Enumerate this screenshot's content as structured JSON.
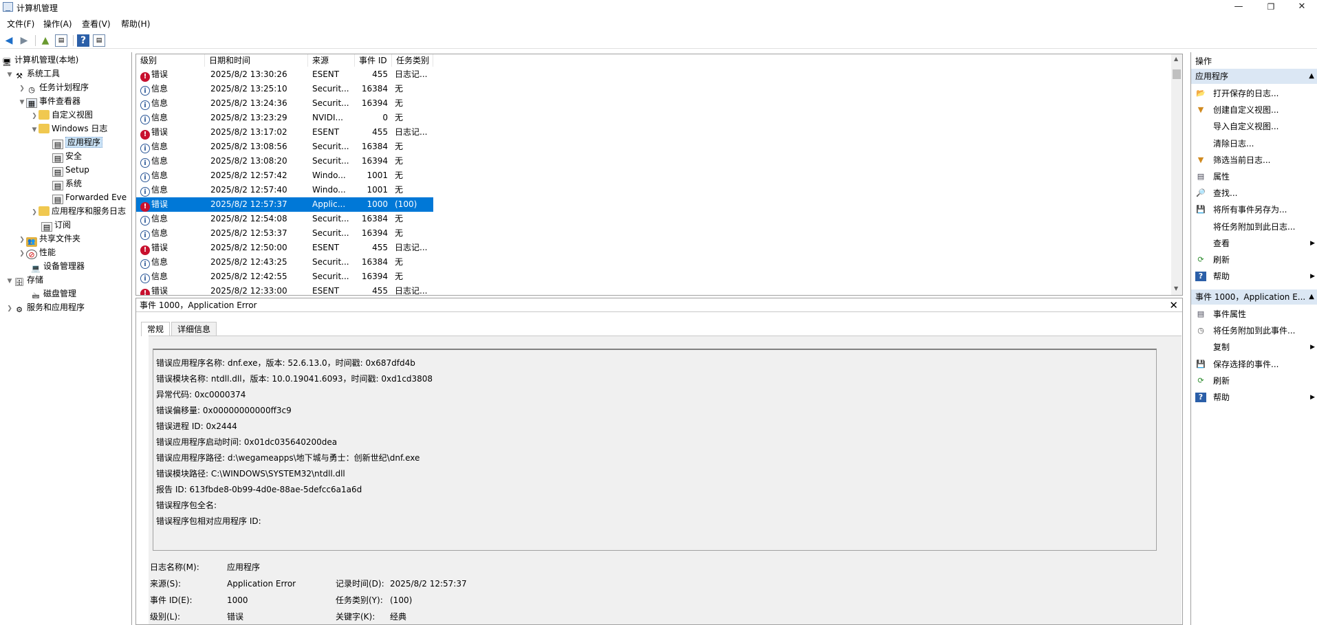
{
  "window": {
    "title": "计算机管理",
    "minimize": "—",
    "restore": "❐",
    "close": "✕"
  },
  "menu": [
    "文件(F)",
    "操作(A)",
    "查看(V)",
    "帮助(H)"
  ],
  "tree": [
    {
      "label": "计算机管理(本地)",
      "icon": "computer-icon"
    },
    {
      "label": "系统工具",
      "icon": "tools-icon"
    },
    {
      "label": "任务计划程序",
      "icon": "clock-icon"
    },
    {
      "label": "事件查看器",
      "icon": "event-viewer-icon"
    },
    {
      "label": "自定义视图",
      "icon": "folder-icon"
    },
    {
      "label": "Windows 日志",
      "icon": "folder-icon"
    },
    {
      "label": "应用程序",
      "icon": "log-icon"
    },
    {
      "label": "安全",
      "icon": "log-icon"
    },
    {
      "label": "Setup",
      "icon": "log-icon"
    },
    {
      "label": "系统",
      "icon": "log-icon"
    },
    {
      "label": "Forwarded Eve",
      "icon": "log-icon"
    },
    {
      "label": "应用程序和服务日志",
      "icon": "folder-icon"
    },
    {
      "label": "订阅",
      "icon": "log-icon"
    },
    {
      "label": "共享文件夹",
      "icon": "share-icon"
    },
    {
      "label": "性能",
      "icon": "performance-icon"
    },
    {
      "label": "设备管理器",
      "icon": "device-icon"
    },
    {
      "label": "存储",
      "icon": "storage-icon"
    },
    {
      "label": "磁盘管理",
      "icon": "disk-icon"
    },
    {
      "label": "服务和应用程序",
      "icon": "services-icon"
    }
  ],
  "grid": {
    "columns": [
      "级别",
      "日期和时间",
      "来源",
      "事件 ID",
      "任务类别"
    ],
    "rows": [
      {
        "level": "错误",
        "date": "2025/8/2 13:30:26",
        "source": "ESENT",
        "id": "455",
        "task": "日志记..."
      },
      {
        "level": "信息",
        "date": "2025/8/2 13:25:10",
        "source": "Securit...",
        "id": "16384",
        "task": "无"
      },
      {
        "level": "信息",
        "date": "2025/8/2 13:24:36",
        "source": "Securit...",
        "id": "16394",
        "task": "无"
      },
      {
        "level": "信息",
        "date": "2025/8/2 13:23:29",
        "source": "NVIDI...",
        "id": "0",
        "task": "无"
      },
      {
        "level": "错误",
        "date": "2025/8/2 13:17:02",
        "source": "ESENT",
        "id": "455",
        "task": "日志记..."
      },
      {
        "level": "信息",
        "date": "2025/8/2 13:08:56",
        "source": "Securit...",
        "id": "16384",
        "task": "无"
      },
      {
        "level": "信息",
        "date": "2025/8/2 13:08:20",
        "source": "Securit...",
        "id": "16394",
        "task": "无"
      },
      {
        "level": "信息",
        "date": "2025/8/2 12:57:42",
        "source": "Windo...",
        "id": "1001",
        "task": "无"
      },
      {
        "level": "信息",
        "date": "2025/8/2 12:57:40",
        "source": "Windo...",
        "id": "1001",
        "task": "无"
      },
      {
        "level": "错误",
        "date": "2025/8/2 12:57:37",
        "source": "Applic...",
        "id": "1000",
        "task": "(100)"
      },
      {
        "level": "信息",
        "date": "2025/8/2 12:54:08",
        "source": "Securit...",
        "id": "16384",
        "task": "无"
      },
      {
        "level": "信息",
        "date": "2025/8/2 12:53:37",
        "source": "Securit...",
        "id": "16394",
        "task": "无"
      },
      {
        "level": "错误",
        "date": "2025/8/2 12:50:00",
        "source": "ESENT",
        "id": "455",
        "task": "日志记..."
      },
      {
        "level": "信息",
        "date": "2025/8/2 12:43:25",
        "source": "Securit...",
        "id": "16384",
        "task": "无"
      },
      {
        "level": "信息",
        "date": "2025/8/2 12:42:55",
        "source": "Securit...",
        "id": "16394",
        "task": "无"
      },
      {
        "level": "错误",
        "date": "2025/8/2 12:33:00",
        "source": "ESENT",
        "id": "455",
        "task": "日志记..."
      }
    ]
  },
  "detail": {
    "title": "事件 1000，Application Error",
    "tabs": [
      "常规",
      "详细信息"
    ],
    "message": [
      "错误应用程序名称: dnf.exe，版本: 52.6.13.0，时间戳: 0x687dfd4b",
      "错误模块名称: ntdll.dll，版本: 10.0.19041.6093，时间戳: 0xd1cd3808",
      "异常代码: 0xc0000374",
      "错误偏移量: 0x00000000000ff3c9",
      "错误进程 ID: 0x2444",
      "错误应用程序启动时间: 0x01dc035640200dea",
      "错误应用程序路径: d:\\wegameapps\\地下城与勇士：创新世纪\\dnf.exe",
      "错误模块路径: C:\\WINDOWS\\SYSTEM32\\ntdll.dll",
      "报告 ID: 613fbde8-0b99-4d0e-88ae-5defcc6a1a6d",
      "错误程序包全名:",
      "错误程序包相对应用程序 ID:"
    ],
    "fields": {
      "log_name_label": "日志名称(M):",
      "log_name": "应用程序",
      "source_label": "来源(S):",
      "source": "Application Error",
      "logged_label": "记录时间(D):",
      "logged": "2025/8/2 12:57:37",
      "event_id_label": "事件 ID(E):",
      "event_id": "1000",
      "task_label": "任务类别(Y):",
      "task": "(100)",
      "level_label": "级别(L):",
      "level": "错误",
      "keywords_label": "关键字(K):",
      "keywords": "经典"
    }
  },
  "actions": {
    "header": "操作",
    "section1": "应用程序",
    "items1": [
      {
        "label": "打开保存的日志...",
        "icon": "open-folder-icon"
      },
      {
        "label": "创建自定义视图...",
        "icon": "filter-icon"
      },
      {
        "label": "导入自定义视图...",
        "icon": ""
      },
      {
        "label": "清除日志...",
        "icon": ""
      },
      {
        "label": "筛选当前日志...",
        "icon": "filter-icon"
      },
      {
        "label": "属性",
        "icon": "properties-icon"
      },
      {
        "label": "查找...",
        "icon": "find-icon"
      },
      {
        "label": "将所有事件另存为...",
        "icon": "save-icon"
      },
      {
        "label": "将任务附加到此日志...",
        "icon": ""
      },
      {
        "label": "查看",
        "icon": "",
        "submenu": true
      },
      {
        "label": "刷新",
        "icon": "refresh-icon"
      },
      {
        "label": "帮助",
        "icon": "help-icon",
        "submenu": true
      }
    ],
    "section2": "事件 1000，Application E...",
    "items2": [
      {
        "label": "事件属性",
        "icon": "properties-icon"
      },
      {
        "label": "将任务附加到此事件...",
        "icon": "task-icon"
      },
      {
        "label": "复制",
        "icon": "",
        "submenu": true
      },
      {
        "label": "保存选择的事件...",
        "icon": "save-icon"
      },
      {
        "label": "刷新",
        "icon": "refresh-icon"
      },
      {
        "label": "帮助",
        "icon": "help-icon",
        "submenu": true
      }
    ]
  }
}
